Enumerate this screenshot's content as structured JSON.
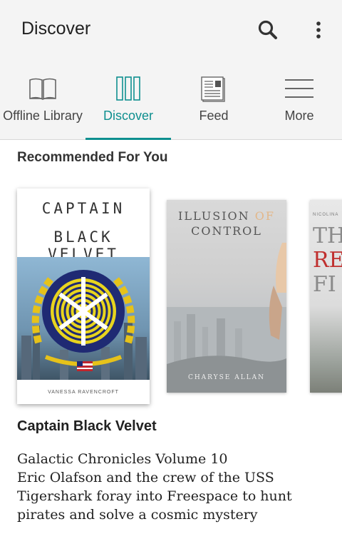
{
  "header": {
    "title": "Discover"
  },
  "tabs": [
    {
      "label": "Offline Library",
      "icon": "book-open-icon",
      "active": false
    },
    {
      "label": "Discover",
      "icon": "bookshelf-icon",
      "active": true
    },
    {
      "label": "Feed",
      "icon": "newspaper-icon",
      "active": false
    },
    {
      "label": "More",
      "icon": "menu-icon",
      "active": false
    }
  ],
  "colors": {
    "accent": "#0e8f8f",
    "toolbar_bg": "#f4f4f4"
  },
  "section": {
    "title": "Recommended For You"
  },
  "books": [
    {
      "cover_title_line1": "CAPTAIN",
      "cover_title_line2": "BLACK VELVET",
      "cover_author": "VANESSA RAVENCROFT"
    },
    {
      "cover_title_a": "ILLUSION",
      "cover_title_b": "OF",
      "cover_title_c": "CONTROL",
      "cover_author": "CHARYSE ALLAN"
    },
    {
      "cover_top": "NICOLINA",
      "cover_line1": "TH",
      "cover_line2": "RE",
      "cover_line3": "FI"
    }
  ],
  "selected": {
    "title": "Captain Black Velvet",
    "description": [
      "Galactic Chronicles Volume 10",
      "Eric Olafson and the crew of the USS",
      "Tigershark foray into Freespace to hunt",
      "pirates and solve a cosmic mystery"
    ]
  }
}
